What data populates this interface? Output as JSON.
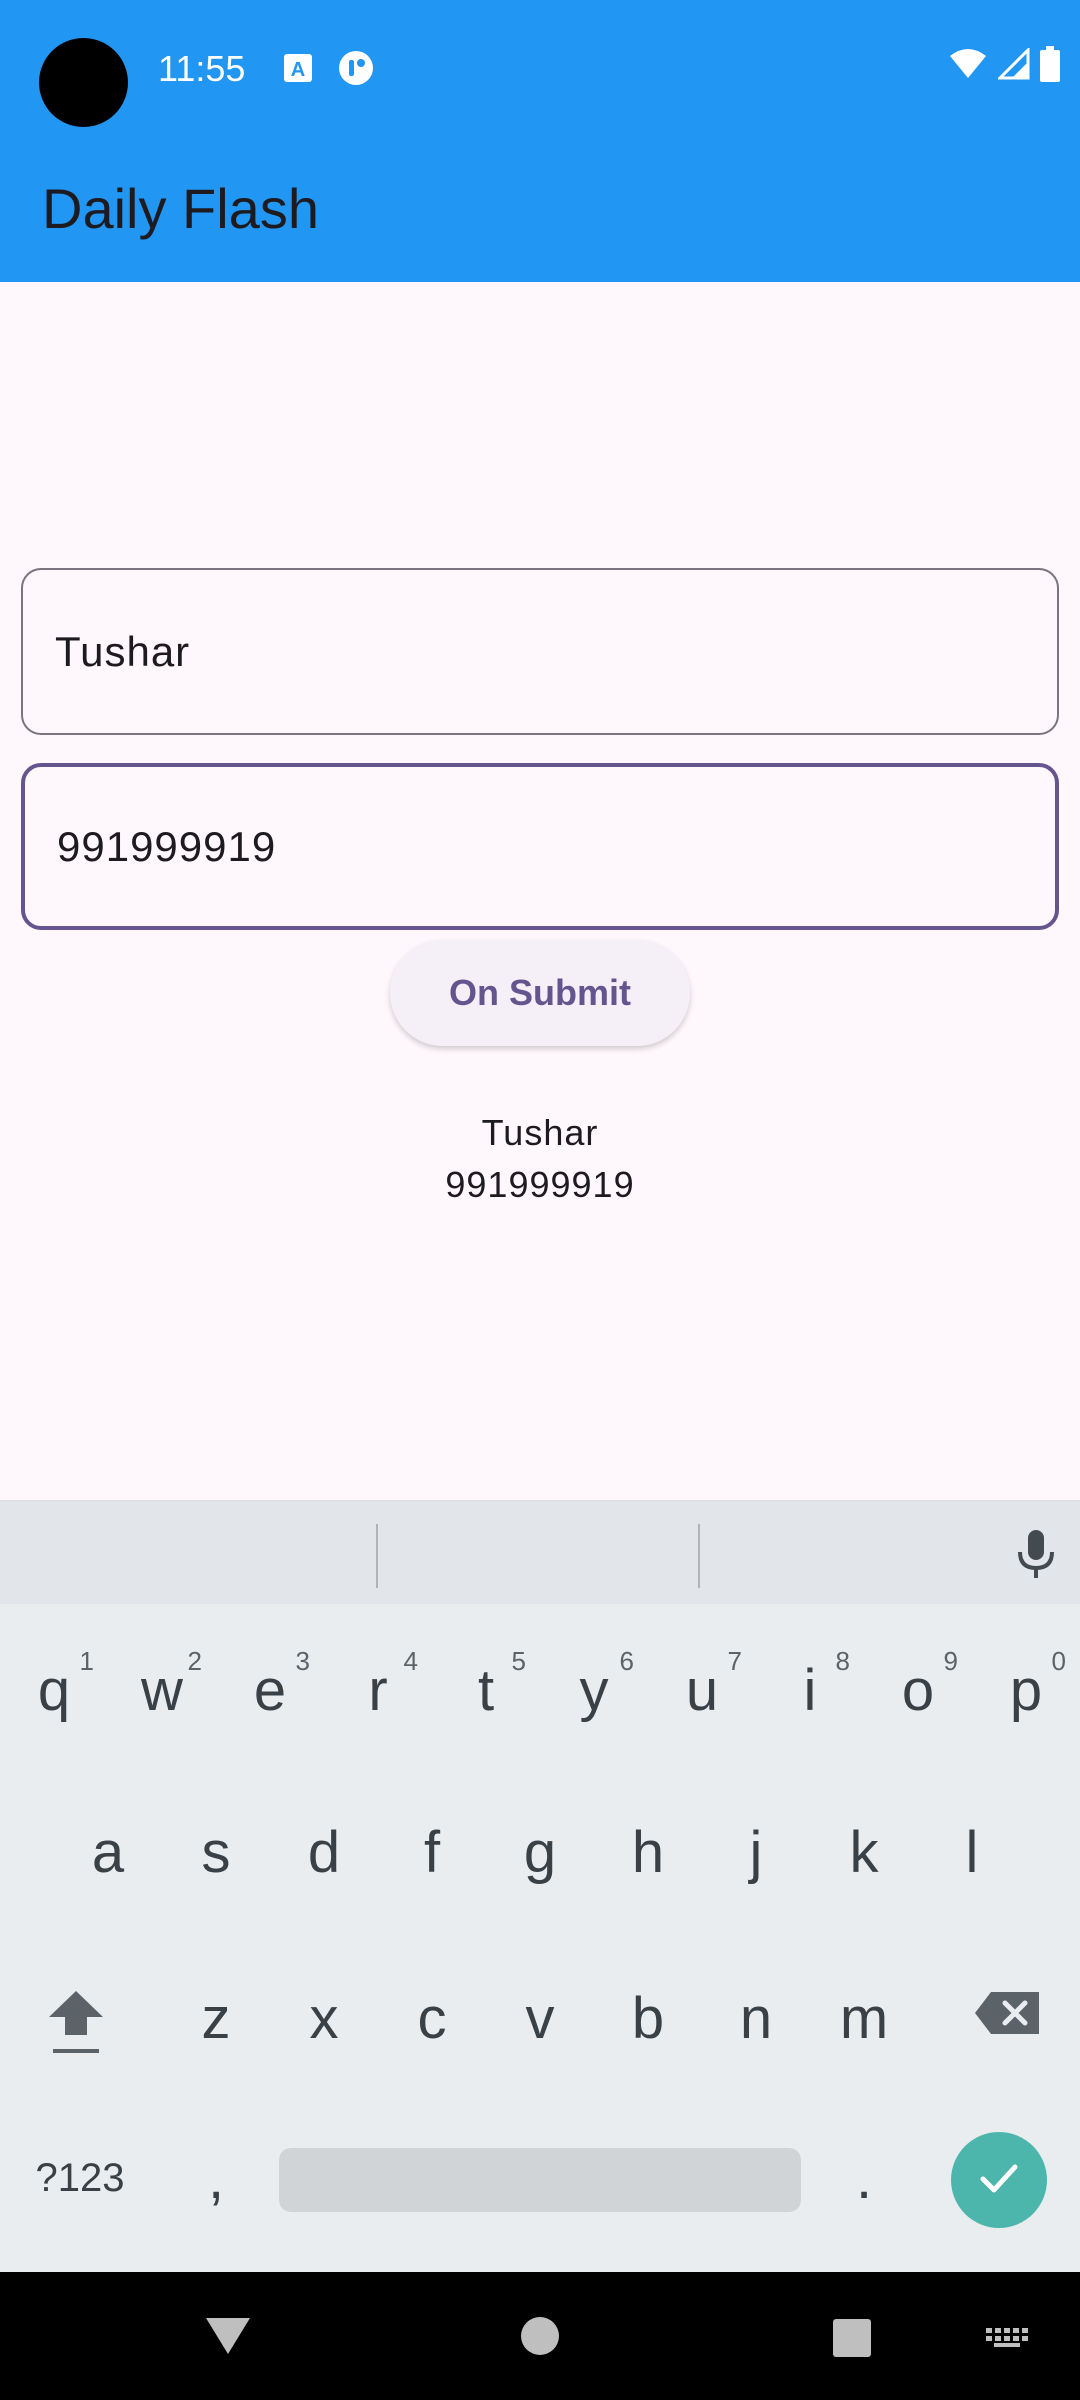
{
  "status_bar": {
    "time": "11:55",
    "icons_left": [
      "text-a-icon",
      "account-circle-icon"
    ],
    "icons_right": [
      "wifi-icon",
      "signal-icon",
      "battery-icon"
    ]
  },
  "app_bar": {
    "title": "Daily Flash",
    "color": "#2196f3"
  },
  "form": {
    "name_value": "Tushar",
    "phone_value": "991999919",
    "submit_label": "On Submit"
  },
  "output": {
    "name": "Tushar",
    "phone": "991999919"
  },
  "keyboard": {
    "row1": [
      {
        "key": "q",
        "hint": "1"
      },
      {
        "key": "w",
        "hint": "2"
      },
      {
        "key": "e",
        "hint": "3"
      },
      {
        "key": "r",
        "hint": "4"
      },
      {
        "key": "t",
        "hint": "5"
      },
      {
        "key": "y",
        "hint": "6"
      },
      {
        "key": "u",
        "hint": "7"
      },
      {
        "key": "i",
        "hint": "8"
      },
      {
        "key": "o",
        "hint": "9"
      },
      {
        "key": "p",
        "hint": "0"
      }
    ],
    "row2": [
      "a",
      "s",
      "d",
      "f",
      "g",
      "h",
      "j",
      "k",
      "l"
    ],
    "row3": [
      "z",
      "x",
      "c",
      "v",
      "b",
      "n",
      "m"
    ],
    "symbols_label": "?123",
    "comma": ",",
    "period": ".",
    "accent": "#4db6ac"
  }
}
